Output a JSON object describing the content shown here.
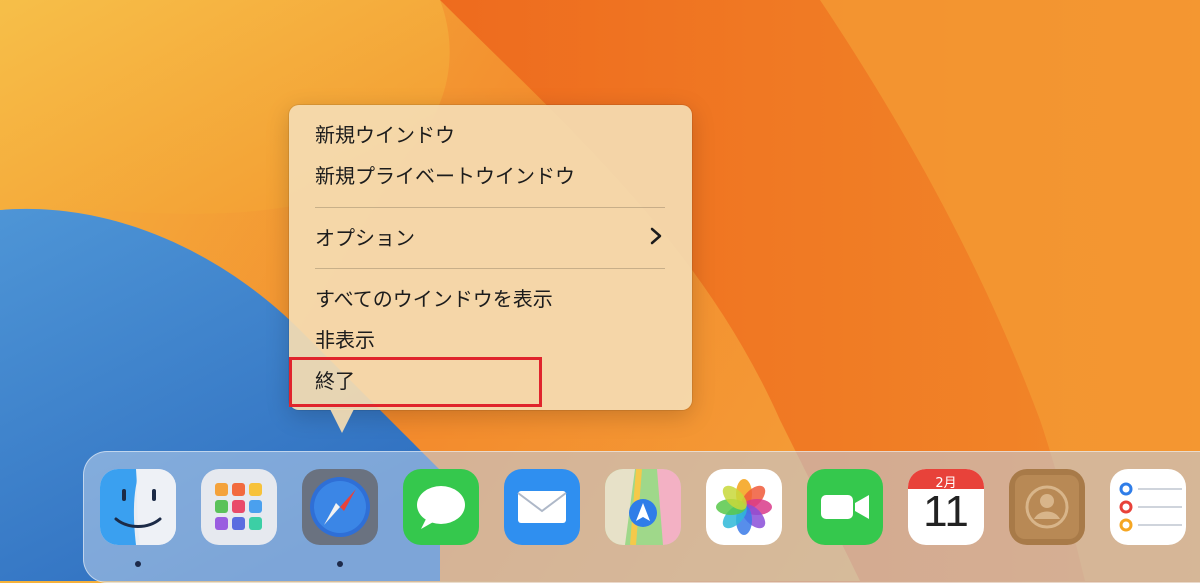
{
  "context_menu": {
    "items": [
      {
        "label": "新規ウインドウ"
      },
      {
        "label": "新規プライベートウインドウ"
      },
      {
        "label": "オプション"
      },
      {
        "label": "すべてのウインドウを表示"
      },
      {
        "label": "非表示"
      },
      {
        "label": "終了"
      }
    ],
    "highlight_color": "#e0242c"
  },
  "dock": {
    "apps": [
      {
        "name": "Finder",
        "icon": "finder-icon",
        "running": true
      },
      {
        "name": "Launchpad",
        "icon": "launchpad-icon",
        "running": false
      },
      {
        "name": "Safari",
        "icon": "safari-icon",
        "running": true
      },
      {
        "name": "Messages",
        "icon": "messages-icon",
        "running": false
      },
      {
        "name": "Mail",
        "icon": "mail-icon",
        "running": false
      },
      {
        "name": "Maps",
        "icon": "maps-icon",
        "running": false
      },
      {
        "name": "Photos",
        "icon": "photos-icon",
        "running": false
      },
      {
        "name": "FaceTime",
        "icon": "facetime-icon",
        "running": false
      },
      {
        "name": "Calendar",
        "icon": "calendar-icon",
        "running": false
      },
      {
        "name": "Contacts",
        "icon": "contacts-icon",
        "running": false
      },
      {
        "name": "Reminders",
        "icon": "reminders-icon",
        "running": false
      }
    ],
    "calendar": {
      "month": "2月",
      "day": "11"
    }
  }
}
